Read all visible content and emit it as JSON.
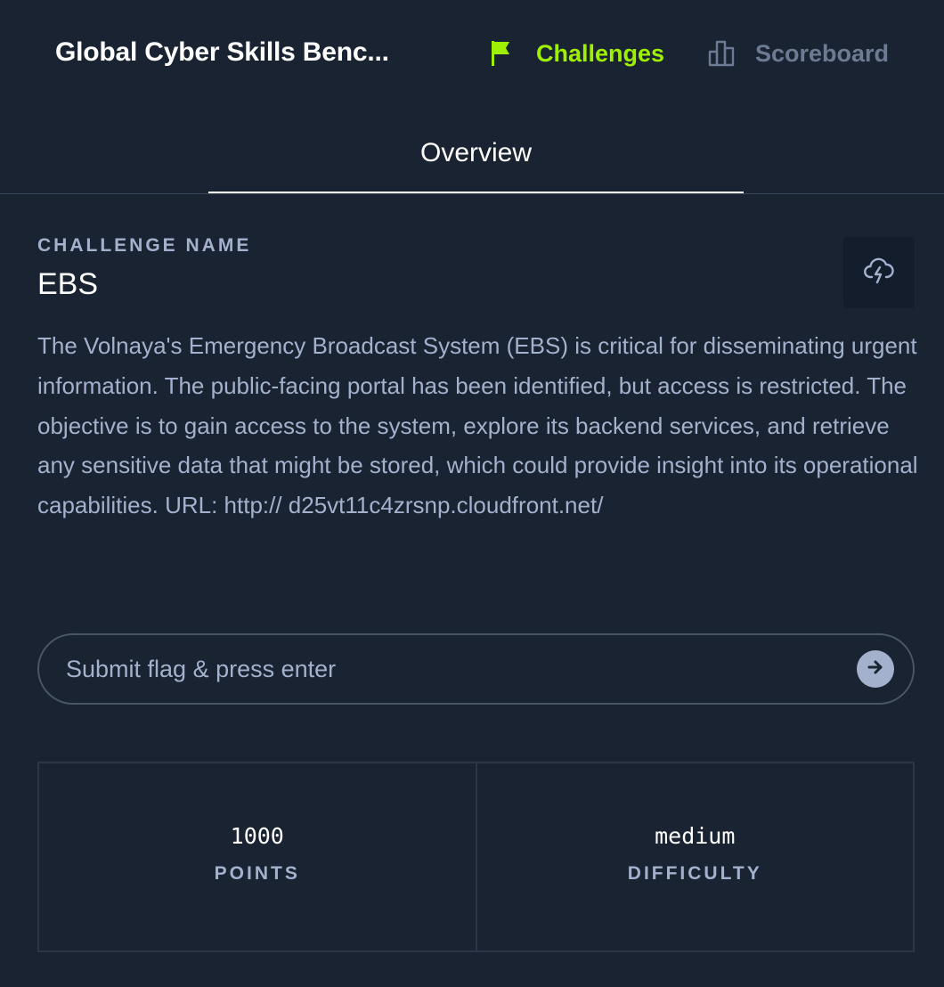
{
  "header": {
    "title": "Global Cyber Skills Benc...",
    "nav": {
      "challenges": {
        "label": "Challenges",
        "icon": "flag-icon",
        "color": "#9fef00"
      },
      "scoreboard": {
        "label": "Scoreboard",
        "icon": "scoreboard-icon",
        "color": "#6c7a92"
      }
    }
  },
  "tabs": [
    {
      "label": "Overview",
      "active": true
    }
  ],
  "challenge": {
    "section_label": "CHALLENGE NAME",
    "name": "EBS",
    "download_icon": "cloud-download-icon",
    "description": "The Volnaya's Emergency Broadcast System (EBS) is critical for disseminating urgent information. The public-facing portal has been identified, but access is restricted. The objective is to gain access to the system, explore its backend services, and retrieve any sensitive data that might be stored, which could provide insight into its operational capabilities. URL: http:// d25vt11c4zrsnp.cloudfront.net/"
  },
  "flag_form": {
    "placeholder": "Submit flag & press enter",
    "value": "",
    "submit_icon": "arrow-right-icon"
  },
  "stats": {
    "points": {
      "value": "1000",
      "label": "POINTS"
    },
    "difficulty": {
      "value": "medium",
      "label": "DIFFICULTY"
    }
  },
  "colors": {
    "background": "#1a2332",
    "accent": "#9fef00",
    "text": "#a4b1cd",
    "heading": "#ffffff"
  }
}
